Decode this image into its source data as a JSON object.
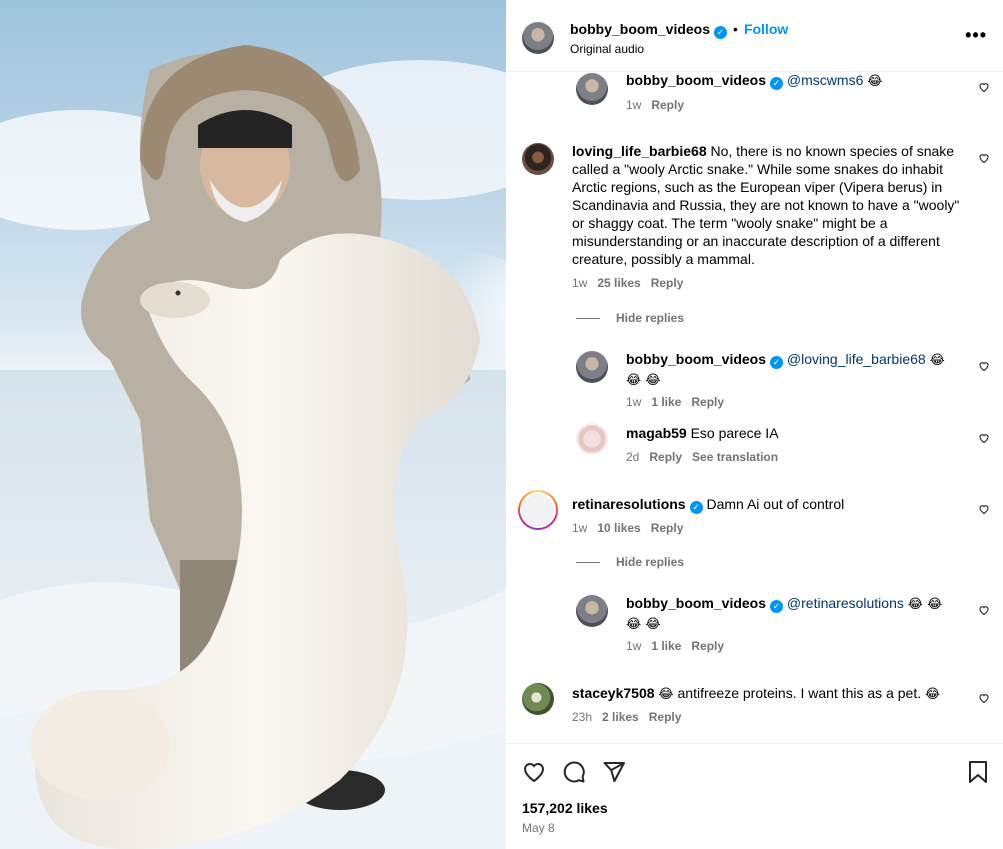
{
  "post": {
    "author": "bobby_boom_videos",
    "follow_label": "Follow",
    "audio": "Original audio",
    "more_icon": "more-options-icon",
    "likes": "157,202 likes",
    "date": "May 8"
  },
  "comments": [
    {
      "user": "bobby_boom_videos",
      "mention": "@mscwms6",
      "text": "",
      "emoji": "😂",
      "time": "1w",
      "likes": "",
      "reply_label": "Reply"
    },
    {
      "user": "loving_life_barbie68",
      "text": "No, there is no known species of snake called a \"wooly Arctic snake.\" While some snakes do inhabit Arctic regions, such as the European viper (Vipera berus) in Scandinavia and Russia, they are not known to have a \"wooly\" or shaggy coat. The term \"wooly snake\" might be a misunderstanding or an inaccurate description of a different creature, possibly a mammal.",
      "time": "1w",
      "likes": "25 likes",
      "reply_label": "Reply",
      "hide_replies": "Hide replies"
    },
    {
      "user": "bobby_boom_videos",
      "mention": "@loving_life_barbie68",
      "emoji": "😂 😂 😂",
      "time": "1w",
      "likes": "1 like",
      "reply_label": "Reply"
    },
    {
      "user": "magab59",
      "text": "Eso parece IA",
      "time": "2d",
      "reply_label": "Reply",
      "translation_label": "See translation"
    },
    {
      "user": "retinaresolutions",
      "text": "Damn Ai out of control",
      "time": "1w",
      "likes": "10 likes",
      "reply_label": "Reply",
      "hide_replies": "Hide replies"
    },
    {
      "user": "bobby_boom_videos",
      "mention": "@retinaresolutions",
      "emoji": "😂 😂 😂 😂",
      "time": "1w",
      "likes": "1 like",
      "reply_label": "Reply"
    },
    {
      "user": "staceyk7508",
      "emoji_before": "😂",
      "text": "antifreeze proteins. I want this as a pet.",
      "emoji_after": "😂",
      "time": "23h",
      "likes": "2 likes",
      "reply_label": "Reply"
    }
  ],
  "colors": {
    "accent": "#0095f6",
    "secondary_text": "#737373",
    "mention": "#00376b"
  }
}
